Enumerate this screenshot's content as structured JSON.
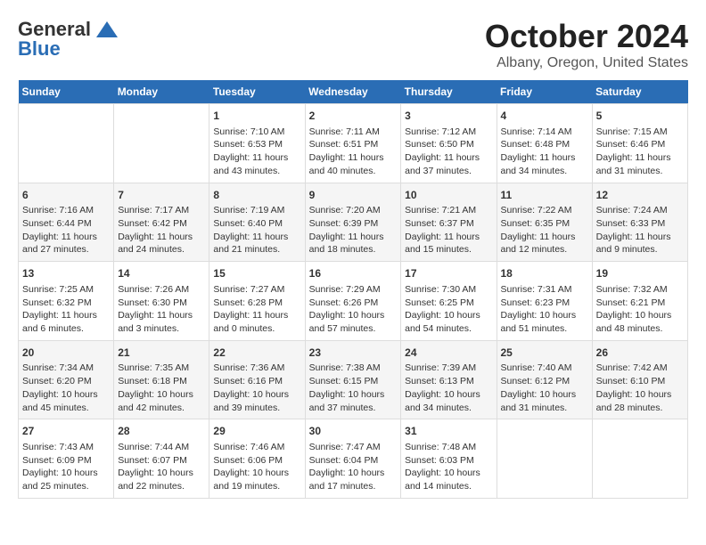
{
  "header": {
    "logo_general": "General",
    "logo_blue": "Blue",
    "title": "October 2024",
    "subtitle": "Albany, Oregon, United States"
  },
  "calendar": {
    "days_of_week": [
      "Sunday",
      "Monday",
      "Tuesday",
      "Wednesday",
      "Thursday",
      "Friday",
      "Saturday"
    ],
    "weeks": [
      [
        {
          "day": "",
          "content": ""
        },
        {
          "day": "",
          "content": ""
        },
        {
          "day": "1",
          "content": "Sunrise: 7:10 AM\nSunset: 6:53 PM\nDaylight: 11 hours and 43 minutes."
        },
        {
          "day": "2",
          "content": "Sunrise: 7:11 AM\nSunset: 6:51 PM\nDaylight: 11 hours and 40 minutes."
        },
        {
          "day": "3",
          "content": "Sunrise: 7:12 AM\nSunset: 6:50 PM\nDaylight: 11 hours and 37 minutes."
        },
        {
          "day": "4",
          "content": "Sunrise: 7:14 AM\nSunset: 6:48 PM\nDaylight: 11 hours and 34 minutes."
        },
        {
          "day": "5",
          "content": "Sunrise: 7:15 AM\nSunset: 6:46 PM\nDaylight: 11 hours and 31 minutes."
        }
      ],
      [
        {
          "day": "6",
          "content": "Sunrise: 7:16 AM\nSunset: 6:44 PM\nDaylight: 11 hours and 27 minutes."
        },
        {
          "day": "7",
          "content": "Sunrise: 7:17 AM\nSunset: 6:42 PM\nDaylight: 11 hours and 24 minutes."
        },
        {
          "day": "8",
          "content": "Sunrise: 7:19 AM\nSunset: 6:40 PM\nDaylight: 11 hours and 21 minutes."
        },
        {
          "day": "9",
          "content": "Sunrise: 7:20 AM\nSunset: 6:39 PM\nDaylight: 11 hours and 18 minutes."
        },
        {
          "day": "10",
          "content": "Sunrise: 7:21 AM\nSunset: 6:37 PM\nDaylight: 11 hours and 15 minutes."
        },
        {
          "day": "11",
          "content": "Sunrise: 7:22 AM\nSunset: 6:35 PM\nDaylight: 11 hours and 12 minutes."
        },
        {
          "day": "12",
          "content": "Sunrise: 7:24 AM\nSunset: 6:33 PM\nDaylight: 11 hours and 9 minutes."
        }
      ],
      [
        {
          "day": "13",
          "content": "Sunrise: 7:25 AM\nSunset: 6:32 PM\nDaylight: 11 hours and 6 minutes."
        },
        {
          "day": "14",
          "content": "Sunrise: 7:26 AM\nSunset: 6:30 PM\nDaylight: 11 hours and 3 minutes."
        },
        {
          "day": "15",
          "content": "Sunrise: 7:27 AM\nSunset: 6:28 PM\nDaylight: 11 hours and 0 minutes."
        },
        {
          "day": "16",
          "content": "Sunrise: 7:29 AM\nSunset: 6:26 PM\nDaylight: 10 hours and 57 minutes."
        },
        {
          "day": "17",
          "content": "Sunrise: 7:30 AM\nSunset: 6:25 PM\nDaylight: 10 hours and 54 minutes."
        },
        {
          "day": "18",
          "content": "Sunrise: 7:31 AM\nSunset: 6:23 PM\nDaylight: 10 hours and 51 minutes."
        },
        {
          "day": "19",
          "content": "Sunrise: 7:32 AM\nSunset: 6:21 PM\nDaylight: 10 hours and 48 minutes."
        }
      ],
      [
        {
          "day": "20",
          "content": "Sunrise: 7:34 AM\nSunset: 6:20 PM\nDaylight: 10 hours and 45 minutes."
        },
        {
          "day": "21",
          "content": "Sunrise: 7:35 AM\nSunset: 6:18 PM\nDaylight: 10 hours and 42 minutes."
        },
        {
          "day": "22",
          "content": "Sunrise: 7:36 AM\nSunset: 6:16 PM\nDaylight: 10 hours and 39 minutes."
        },
        {
          "day": "23",
          "content": "Sunrise: 7:38 AM\nSunset: 6:15 PM\nDaylight: 10 hours and 37 minutes."
        },
        {
          "day": "24",
          "content": "Sunrise: 7:39 AM\nSunset: 6:13 PM\nDaylight: 10 hours and 34 minutes."
        },
        {
          "day": "25",
          "content": "Sunrise: 7:40 AM\nSunset: 6:12 PM\nDaylight: 10 hours and 31 minutes."
        },
        {
          "day": "26",
          "content": "Sunrise: 7:42 AM\nSunset: 6:10 PM\nDaylight: 10 hours and 28 minutes."
        }
      ],
      [
        {
          "day": "27",
          "content": "Sunrise: 7:43 AM\nSunset: 6:09 PM\nDaylight: 10 hours and 25 minutes."
        },
        {
          "day": "28",
          "content": "Sunrise: 7:44 AM\nSunset: 6:07 PM\nDaylight: 10 hours and 22 minutes."
        },
        {
          "day": "29",
          "content": "Sunrise: 7:46 AM\nSunset: 6:06 PM\nDaylight: 10 hours and 19 minutes."
        },
        {
          "day": "30",
          "content": "Sunrise: 7:47 AM\nSunset: 6:04 PM\nDaylight: 10 hours and 17 minutes."
        },
        {
          "day": "31",
          "content": "Sunrise: 7:48 AM\nSunset: 6:03 PM\nDaylight: 10 hours and 14 minutes."
        },
        {
          "day": "",
          "content": ""
        },
        {
          "day": "",
          "content": ""
        }
      ]
    ]
  }
}
